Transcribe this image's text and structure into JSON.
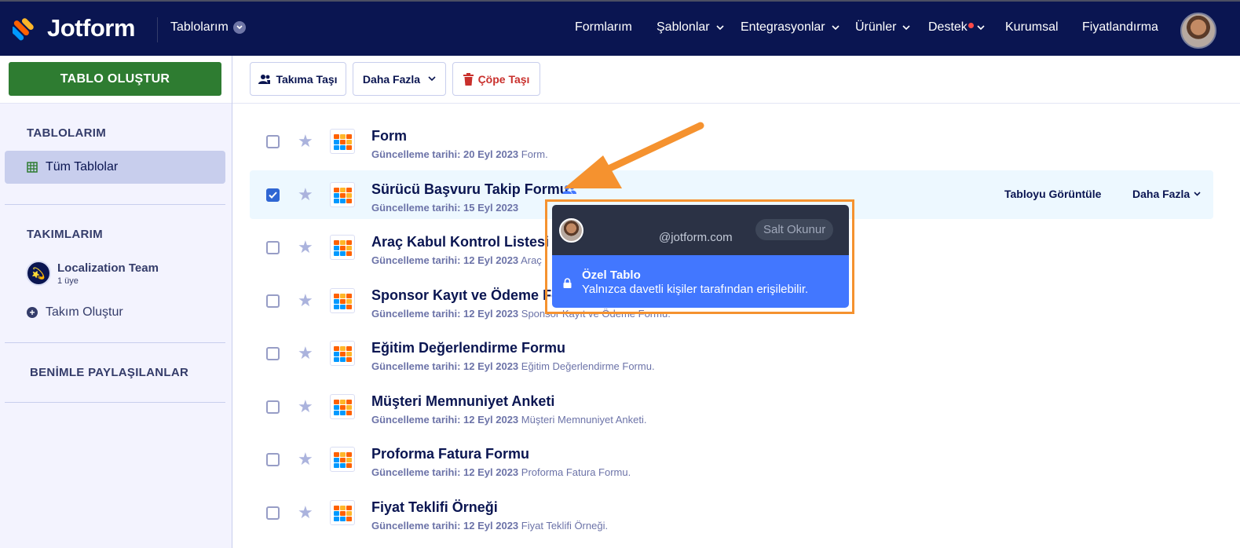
{
  "brand": {
    "name": "Jotform"
  },
  "app_switch": {
    "label": "Tablolarım"
  },
  "nav": {
    "items": [
      {
        "label": "Formlarım",
        "dropdown": false
      },
      {
        "label": "Şablonlar",
        "dropdown": true
      },
      {
        "label": "Entegrasyonlar",
        "dropdown": true
      },
      {
        "label": "Ürünler",
        "dropdown": true
      },
      {
        "label": "Destek",
        "dropdown": true,
        "notification_dot": true
      },
      {
        "label": "Kurumsal",
        "dropdown": false
      },
      {
        "label": "Fiyatlandırma",
        "dropdown": false
      }
    ]
  },
  "sidebar": {
    "create_button": "TABLO OLUŞTUR",
    "tables_heading": "TABLOLARIM",
    "all_tables": "Tüm Tablolar",
    "teams_heading": "TAKIMLARIM",
    "team": {
      "name": "Localization Team",
      "members": "1 üye"
    },
    "create_team": "Takım Oluştur",
    "shared_heading": "BENİMLE PAYLAŞILANLAR"
  },
  "toolbar": {
    "move_to_team": "Takıma Taşı",
    "more": "Daha Fazla",
    "trash": "Çöpe Taşı"
  },
  "rows": [
    {
      "title": "Form",
      "date": "Güncelleme tarihi: 20 Eyl 2023",
      "desc": "Form.",
      "selected": false
    },
    {
      "title": "Sürücü Başvuru Takip Formu",
      "date": "Güncelleme tarihi: 15 Eyl 2023",
      "desc": "",
      "selected": true,
      "shared_icon": "team-icon",
      "view_label": "Tabloyu Görüntüle",
      "more_label": "Daha Fazla"
    },
    {
      "title": "Araç Kabul Kontrol Listesi",
      "date": "Güncelleme tarihi: 12 Eyl 2023",
      "desc": "Araç",
      "selected": false
    },
    {
      "title": "Sponsor Kayıt ve Ödeme Fo",
      "date": "Güncelleme tarihi: 12 Eyl 2023",
      "desc": "Sponsor Kayıt ve Ödeme Formu.",
      "selected": false
    },
    {
      "title": "Eğitim Değerlendirme Formu",
      "date": "Güncelleme tarihi: 12 Eyl 2023",
      "desc": "Eğitim Değerlendirme Formu.",
      "selected": false
    },
    {
      "title": "Müşteri Memnuniyet Anketi",
      "date": "Güncelleme tarihi: 12 Eyl 2023",
      "desc": "Müşteri Memnuniyet Anketi.",
      "selected": false
    },
    {
      "title": "Proforma Fatura Formu",
      "date": "Güncelleme tarihi: 12 Eyl 2023",
      "desc": "Proforma Fatura Formu.",
      "selected": false
    },
    {
      "title": "Fiyat Teklifi Örneği",
      "date": "Güncelleme tarihi: 12 Eyl 2023",
      "desc": "Fiyat Teklifi Örneği.",
      "selected": false
    }
  ],
  "popup": {
    "email": "@jotform.com",
    "role_badge": "Salt Okunur",
    "privacy_title": "Özel Tablo",
    "privacy_desc": "Yalnızca davetli kişiler tarafından erişilebilir."
  },
  "colors": {
    "navy": "#0a1551",
    "create_green": "#2e7c31",
    "annotation_orange": "#f5922f",
    "popup_blue": "#4277ff",
    "checkbox_blue": "#2f66d3"
  }
}
